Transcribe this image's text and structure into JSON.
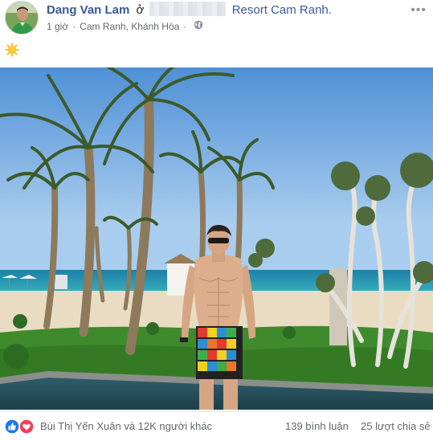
{
  "post": {
    "author": "Dang Van Lam",
    "at_word": "ở",
    "place": "Resort Cam Ranh.",
    "time": "1 giờ",
    "separator": "·",
    "location": "Cam Ranh, Khánh Hòa",
    "privacy_icon": "globe-icon",
    "status_icon": "sun-emoji"
  },
  "footer": {
    "reactions": [
      "like",
      "love"
    ],
    "reaction_names": "Bùi Thị Yến Xuân và 12K người khác",
    "comments": "139 bình luận",
    "shares": "25 lượt chia sẻ"
  },
  "colors": {
    "link": "#385898",
    "meta": "#616770",
    "like_blue": "#1877f2",
    "love_red": "#f33e58"
  }
}
